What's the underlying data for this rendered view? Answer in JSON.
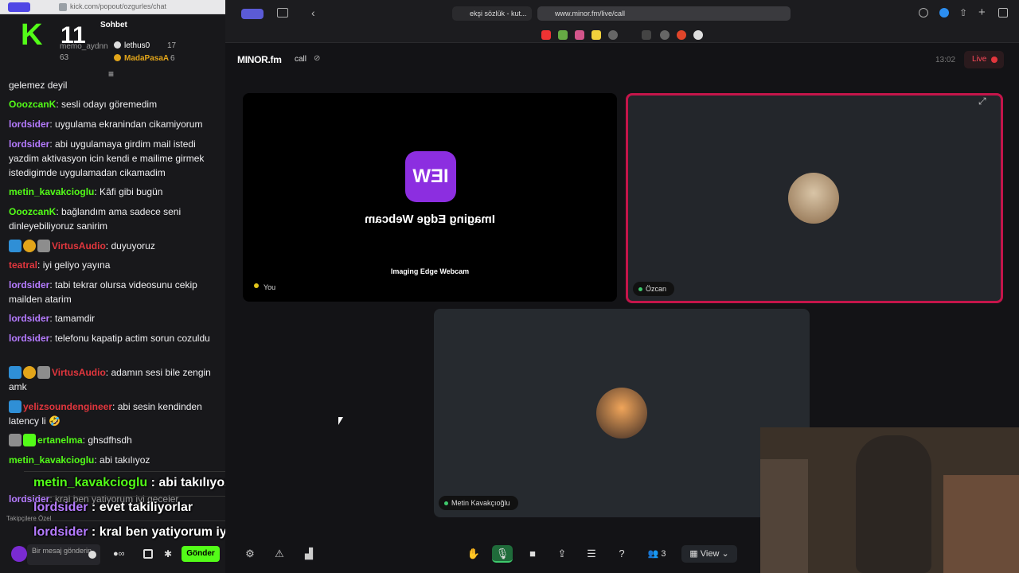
{
  "chat_window": {
    "url": "kick.com/popout/ozgurles/chat",
    "header_title": "Sohbet",
    "logo_letter": "K",
    "logo_number": "11",
    "leaderboard": [
      {
        "name": "memo_aydnn",
        "value": "63"
      },
      {
        "name": "lethus0",
        "value": "17"
      },
      {
        "name": "MadaPasaA",
        "value": "6"
      }
    ],
    "messages": [
      {
        "user": "",
        "text": "gelemez deyil",
        "color": "#efeff1"
      },
      {
        "user": "OoozcanK",
        "text": ": sesli odayı göremedim",
        "color": "#53fc18"
      },
      {
        "user": "lordsider",
        "text": ": uygulama ekranindan cikamiyorum",
        "color": "#b57bff"
      },
      {
        "user": "lordsider",
        "text": ": abi uygulamaya girdim mail istedi yazdim aktivasyon icin kendi e mailime girmek istedigimde uygulamadan cikamadim",
        "color": "#b57bff"
      },
      {
        "user": "metin_kavakcioglu",
        "text": ": Kâfi gibi bugün",
        "color": "#53fc18"
      },
      {
        "user": "OoozcanK",
        "text": ": bağlandım ama sadece seni dinleyebiliyoruz sanirim",
        "color": "#53fc18"
      },
      {
        "user": "VirtusAudio",
        "text": ": duyuyoruz",
        "color": "#e2363d"
      },
      {
        "user": "teatral",
        "text": ": iyi geliyo yayına",
        "color": "#e2363d"
      },
      {
        "user": "lordsider",
        "text": ": tabi tekrar olursa videosunu cekip mailden atarim",
        "color": "#b57bff"
      },
      {
        "user": "lordsider",
        "text": ": tamamdir",
        "color": "#b57bff"
      },
      {
        "user": "lordsider",
        "text": ": telefonu kapatip actim sorun cozuldu",
        "color": "#b57bff"
      },
      {
        "user": "VirtusAudio",
        "text": ": adamın sesi bile zengin amk",
        "color": "#e2363d"
      },
      {
        "user": "yelizsoundengineer",
        "text": ": abi sesin kendinden latency li 🤣",
        "color": "#e2363d"
      },
      {
        "user": "ertanelma",
        "text": ": ghsdfhsdh",
        "color": "#53fc18"
      },
      {
        "user": "metin_kavakcioglu",
        "text": ": abi takılıyoz",
        "color": "#53fc18"
      },
      {
        "user": "lordsider",
        "text": ": kral ben yatiyorum iyi geceler",
        "color": "#b57bff"
      }
    ],
    "overlay": [
      {
        "user": "metin_kavakcioglu",
        "text": " : abi takılıyoz",
        "color": "#53fc18"
      },
      {
        "user": "lordsider",
        "text": " : evet takiliyorlar",
        "color": "#b57bff"
      },
      {
        "user": "lordsider",
        "text": " : kral ben yatiyorum iyi geceler",
        "color": "#b57bff"
      }
    ],
    "followers_label": "Takipçilere Özel",
    "input_placeholder": "Bir mesaj gönderin",
    "send_label": "Gönder"
  },
  "browser": {
    "tabs": [
      {
        "label": "ekşi sözlük - kut..."
      },
      {
        "label": "www.minor.fm/live/call"
      }
    ]
  },
  "app": {
    "logo": "MINOR.fm",
    "page": "call",
    "time": "13:02",
    "live_label": "Live",
    "tiles": [
      {
        "name": "You",
        "device_caption": "Imaging Edge Webcam",
        "mirrored_text": "Imaging Edge Webcam",
        "app_icon_text": "IEW"
      },
      {
        "name": "Özcan"
      },
      {
        "name": "Metin Kavakçıoğlu"
      }
    ],
    "controls": {
      "participants": "3",
      "view_label": "View"
    }
  }
}
